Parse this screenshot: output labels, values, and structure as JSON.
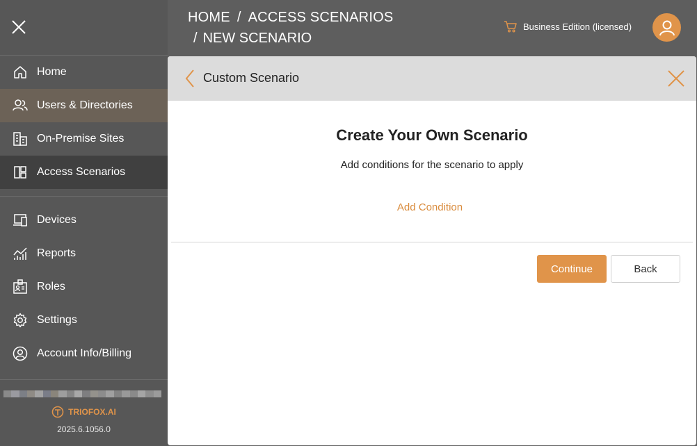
{
  "sidebar": {
    "close_icon": "close-icon",
    "nav_primary": [
      {
        "label": "Home",
        "icon": "home-icon"
      },
      {
        "label": "Users & Directories",
        "icon": "users-icon"
      },
      {
        "label": "On-Premise Sites",
        "icon": "building-icon"
      },
      {
        "label": "Access Scenarios",
        "icon": "layout-icon"
      }
    ],
    "nav_secondary": [
      {
        "label": "Devices",
        "icon": "devices-icon"
      },
      {
        "label": "Reports",
        "icon": "reports-icon"
      },
      {
        "label": "Roles",
        "icon": "id-badge-icon"
      },
      {
        "label": "Settings",
        "icon": "gear-icon"
      },
      {
        "label": "Account Info/Billing",
        "icon": "user-circle-icon"
      }
    ],
    "footer": {
      "brand": "TRIOFOX.AI",
      "version": "2025.6.1056.0"
    }
  },
  "header": {
    "breadcrumb": [
      "HOME",
      "ACCESS SCENARIOS",
      "NEW SCENARIO"
    ],
    "separator": "/",
    "license": "Business Edition (licensed)"
  },
  "panel": {
    "title": "Custom Scenario",
    "heading": "Create Your Own Scenario",
    "subheading": "Add conditions for the scenario to apply",
    "add_condition": "Add Condition",
    "continue_label": "Continue",
    "back_label": "Back"
  },
  "colors": {
    "accent": "#e0944a",
    "sidebar_bg": "#575757",
    "header_bg": "#5e5e5e",
    "active_users_bg": "#6c6257",
    "active_access_bg": "#404040",
    "panel_header_bg": "#dcdcdc"
  }
}
